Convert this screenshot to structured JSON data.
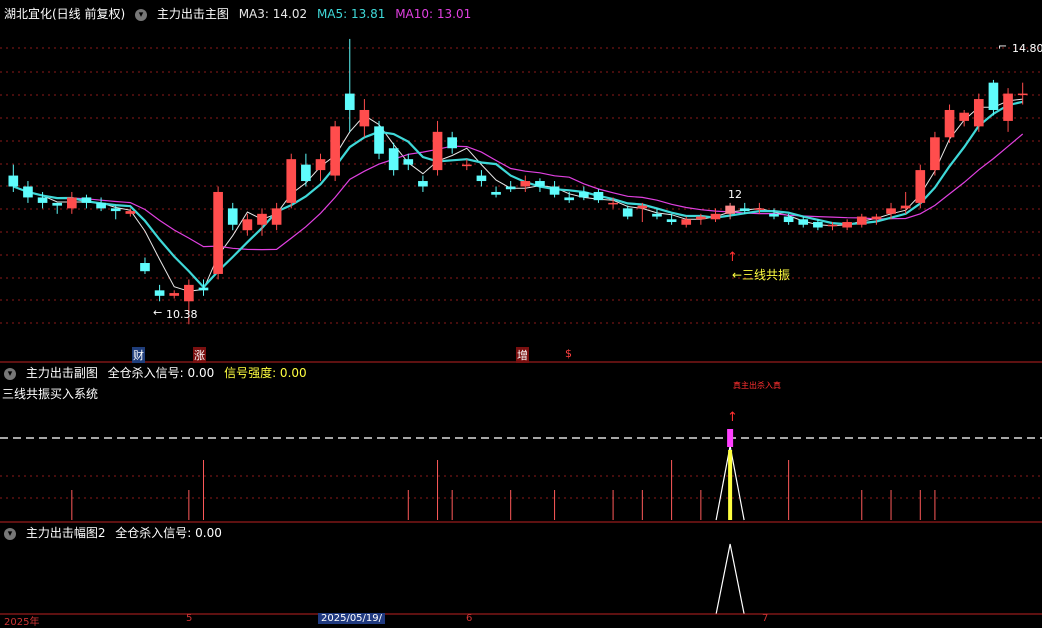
{
  "main_panel": {
    "stock": "湖北宜化(日线 前复权)",
    "indicator": "主力出击主图",
    "ma3_label": "MA3: 14.02",
    "ma5_label": "MA5: 13.81",
    "ma10_label": "MA10: 13.01",
    "high_label": "14.80",
    "low_label": "10.38",
    "signal_count": "12",
    "signal_text": "←三线共振",
    "markers": [
      "财",
      "涨",
      "增",
      "$"
    ]
  },
  "sub_panel_1": {
    "title": "主力出击副图",
    "kill_label": "全仓杀入信号: 0.00",
    "strength_label": "信号强度: 0.00",
    "system_name": "三线共振买入系统",
    "top_text": "真主出杀入真"
  },
  "sub_panel_2": {
    "title": "主力出击幅图2",
    "kill_label": "全仓杀入信号: 0.00"
  },
  "date_axis": [
    "2025年",
    "5",
    "2025/05/19/",
    "6",
    "7"
  ],
  "colors": {
    "up": "#ff4d4d",
    "down": "#5ffcfc",
    "ma3": "#e8e8e8",
    "ma5": "#3fd8d8",
    "ma10": "#e040e0",
    "yellow": "#ffff40",
    "grid": "#8b1a1a"
  },
  "chart_data": {
    "type": "candlestick",
    "candles": [
      [
        13.1,
        13.3,
        12.8,
        12.9
      ],
      [
        12.9,
        13.0,
        12.6,
        12.7
      ],
      [
        12.7,
        12.8,
        12.5,
        12.6
      ],
      [
        12.6,
        12.6,
        12.4,
        12.55
      ],
      [
        12.5,
        12.8,
        12.4,
        12.7
      ],
      [
        12.7,
        12.75,
        12.5,
        12.6
      ],
      [
        12.6,
        12.7,
        12.45,
        12.5
      ],
      [
        12.5,
        12.55,
        12.3,
        12.45
      ],
      [
        12.4,
        12.5,
        12.35,
        12.45
      ],
      [
        11.5,
        11.6,
        11.3,
        11.35
      ],
      [
        11.0,
        11.1,
        10.8,
        10.9
      ],
      [
        10.9,
        11.0,
        10.85,
        10.95
      ],
      [
        10.8,
        11.2,
        10.38,
        11.1
      ],
      [
        11.05,
        11.2,
        10.9,
        11.0
      ],
      [
        11.3,
        12.9,
        11.2,
        12.8
      ],
      [
        12.5,
        12.6,
        12.1,
        12.2
      ],
      [
        12.1,
        12.4,
        12.0,
        12.3
      ],
      [
        12.2,
        12.5,
        12.0,
        12.4
      ],
      [
        12.2,
        12.6,
        12.1,
        12.5
      ],
      [
        12.6,
        13.5,
        12.5,
        13.4
      ],
      [
        13.3,
        13.5,
        12.9,
        13.0
      ],
      [
        13.2,
        13.5,
        13.0,
        13.4
      ],
      [
        13.1,
        14.1,
        13.0,
        14.0
      ],
      [
        14.6,
        15.6,
        13.9,
        14.3
      ],
      [
        14.0,
        14.5,
        13.8,
        14.3
      ],
      [
        14.0,
        14.1,
        13.4,
        13.5
      ],
      [
        13.6,
        13.7,
        13.1,
        13.2
      ],
      [
        13.4,
        13.5,
        13.2,
        13.3
      ],
      [
        13.0,
        13.1,
        12.8,
        12.9
      ],
      [
        13.2,
        14.1,
        13.1,
        13.9
      ],
      [
        13.8,
        13.9,
        13.5,
        13.6
      ],
      [
        13.3,
        13.4,
        13.2,
        13.3
      ],
      [
        13.1,
        13.2,
        12.9,
        13.0
      ],
      [
        12.8,
        12.9,
        12.7,
        12.75
      ],
      [
        12.9,
        13.0,
        12.8,
        12.85
      ],
      [
        12.9,
        13.1,
        12.8,
        13.0
      ],
      [
        13.0,
        13.05,
        12.8,
        12.9
      ],
      [
        12.9,
        13.0,
        12.7,
        12.75
      ],
      [
        12.7,
        12.8,
        12.6,
        12.65
      ],
      [
        12.8,
        12.9,
        12.65,
        12.7
      ],
      [
        12.8,
        12.85,
        12.6,
        12.65
      ],
      [
        12.6,
        12.7,
        12.5,
        12.6
      ],
      [
        12.5,
        12.55,
        12.3,
        12.35
      ],
      [
        12.5,
        12.6,
        12.25,
        12.55
      ],
      [
        12.4,
        12.5,
        12.3,
        12.35
      ],
      [
        12.3,
        12.4,
        12.2,
        12.25
      ],
      [
        12.2,
        12.35,
        12.15,
        12.3
      ],
      [
        12.3,
        12.4,
        12.2,
        12.35
      ],
      [
        12.3,
        12.5,
        12.25,
        12.4
      ],
      [
        12.4,
        12.6,
        12.3,
        12.55
      ],
      [
        12.5,
        12.6,
        12.4,
        12.45
      ],
      [
        12.5,
        12.6,
        12.4,
        12.5
      ],
      [
        12.4,
        12.5,
        12.3,
        12.35
      ],
      [
        12.35,
        12.4,
        12.2,
        12.25
      ],
      [
        12.3,
        12.35,
        12.15,
        12.2
      ],
      [
        12.25,
        12.3,
        12.1,
        12.15
      ],
      [
        12.2,
        12.25,
        12.1,
        12.2
      ],
      [
        12.15,
        12.3,
        12.1,
        12.25
      ],
      [
        12.2,
        12.4,
        12.15,
        12.35
      ],
      [
        12.3,
        12.4,
        12.2,
        12.35
      ],
      [
        12.4,
        12.6,
        12.3,
        12.5
      ],
      [
        12.5,
        12.8,
        12.4,
        12.55
      ],
      [
        12.6,
        13.3,
        12.5,
        13.2
      ],
      [
        13.2,
        13.9,
        13.1,
        13.8
      ],
      [
        13.8,
        14.4,
        13.7,
        14.3
      ],
      [
        14.1,
        14.3,
        14.0,
        14.25
      ],
      [
        14.0,
        14.6,
        13.9,
        14.5
      ],
      [
        14.8,
        14.85,
        14.2,
        14.3
      ],
      [
        14.1,
        14.7,
        13.9,
        14.6
      ],
      [
        14.6,
        14.8,
        14.4,
        14.6
      ]
    ],
    "ma3_last": 14.02,
    "ma5_last": 13.81,
    "ma10_last": 13.01,
    "ylim": [
      10.0,
      15.8
    ],
    "signal_index": 49,
    "sub1_spikes": [
      4,
      12,
      13,
      27,
      29,
      30,
      34,
      37,
      41,
      43,
      45,
      47,
      53,
      58,
      60,
      62,
      63
    ],
    "sub1_signal_index": 49
  }
}
